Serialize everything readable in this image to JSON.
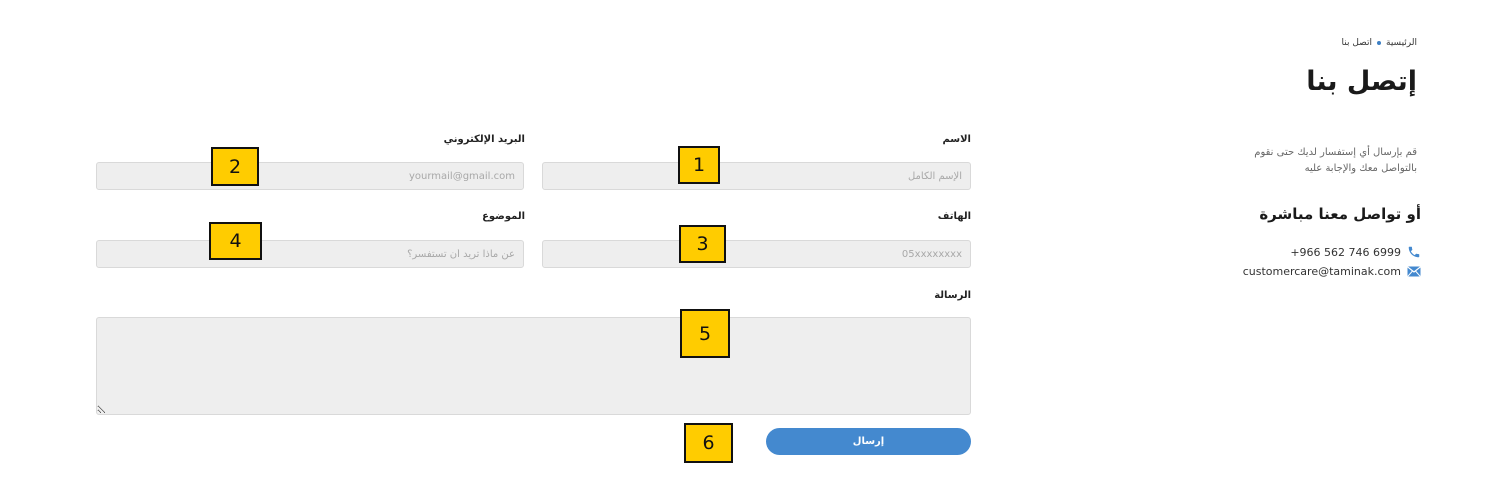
{
  "breadcrumb": {
    "home": "الرئيسية",
    "current": "اتصل بنا"
  },
  "page": {
    "title": "إتصل بنا",
    "intro": "قم بإرسال أي إستفسار لديك حتى نقوم بالتواصل معك والإجابة عليه"
  },
  "direct": {
    "title": "أو تواصل معنا مباشرة",
    "phone": "+966 562 746 6999",
    "email": "customercare@taminak.com"
  },
  "form": {
    "name": {
      "label": "الاسم",
      "placeholder": "الإسم الكامل"
    },
    "email": {
      "label": "البريد الإلكتروني",
      "placeholder": "yourmail@gmail.com"
    },
    "phone": {
      "label": "الهاتف",
      "placeholder": "05xxxxxxxx"
    },
    "subject": {
      "label": "الموضوع",
      "placeholder": "عن ماذا تريد أن تستفسر؟"
    },
    "message": {
      "label": "الرسالة",
      "placeholder": ""
    },
    "submit_label": "إرسال"
  },
  "markers": [
    "1",
    "2",
    "3",
    "4",
    "5",
    "6"
  ],
  "colors": {
    "accent": "#4489cf",
    "marker": "#ffcc00",
    "field_bg": "#eeeeee"
  },
  "icons": {
    "phone": "phone-icon",
    "email": "envelope-icon"
  }
}
